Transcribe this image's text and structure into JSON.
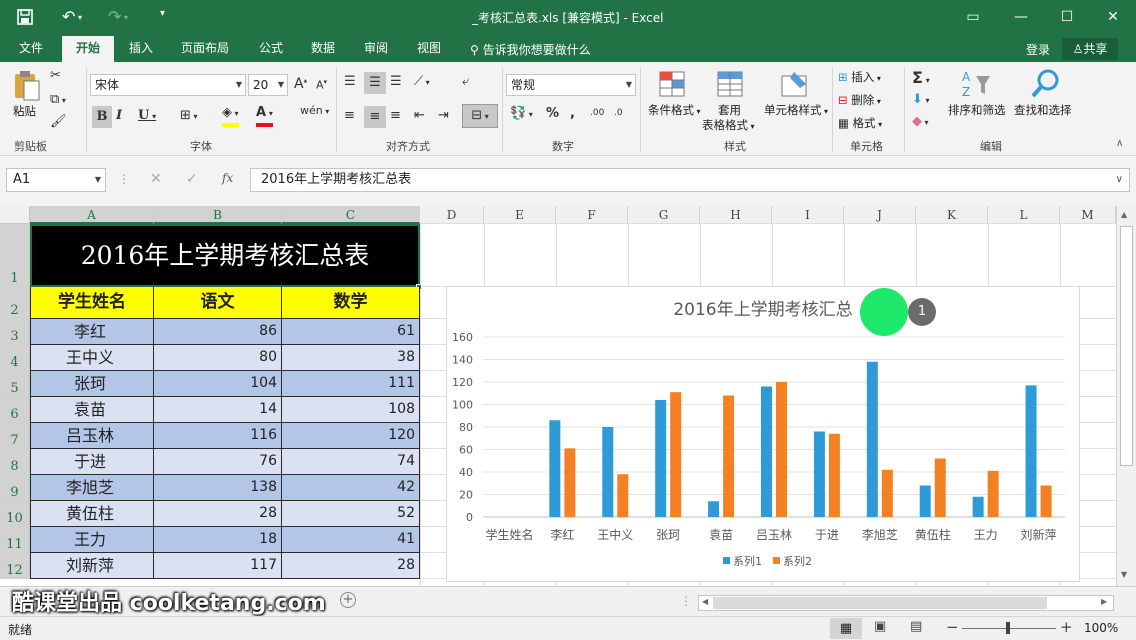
{
  "app": {
    "title": "_考核汇总表.xls  [兼容模式] - Excel",
    "accent": "#217346"
  },
  "tabs": [
    "文件",
    "开始",
    "插入",
    "页面布局",
    "公式",
    "数据",
    "审阅",
    "视图"
  ],
  "tellme": "告诉我你想要做什么",
  "account": {
    "login": "登录",
    "share": "共享"
  },
  "ribbon": {
    "clipboard": {
      "paste": "粘贴",
      "label": "剪贴板"
    },
    "font": {
      "name": "宋体",
      "size": "20",
      "label": "字体"
    },
    "alignment": {
      "label": "对齐方式"
    },
    "number": {
      "format": "常规",
      "label": "数字"
    },
    "styles": {
      "conditional": "条件格式",
      "table_format_1": "套用",
      "table_format_2": "表格格式",
      "cell_styles": "单元格样式",
      "label": "样式"
    },
    "cells": {
      "insert": "插入",
      "delete": "删除",
      "format": "格式",
      "label": "单元格"
    },
    "editing": {
      "sort": "排序和筛选",
      "find": "查找和选择",
      "label": "编辑"
    }
  },
  "formula_bar": {
    "name_box": "A1",
    "fx": "fx",
    "value": "2016年上学期考核汇总表"
  },
  "columns": [
    "A",
    "B",
    "C",
    "D",
    "E",
    "F",
    "G",
    "H",
    "I",
    "J",
    "K",
    "L",
    "M"
  ],
  "rows": [
    "1",
    "2",
    "3",
    "4",
    "5",
    "6",
    "7",
    "8",
    "9",
    "10",
    "11",
    "12"
  ],
  "sheet": {
    "title": "2016年上学期考核汇总表",
    "headers": [
      "学生姓名",
      "语文",
      "数学"
    ],
    "data": [
      [
        "李红",
        "86",
        "61"
      ],
      [
        "王中义",
        "80",
        "38"
      ],
      [
        "张珂",
        "104",
        "111"
      ],
      [
        "袁苗",
        "14",
        "108"
      ],
      [
        "吕玉林",
        "116",
        "120"
      ],
      [
        "于进",
        "76",
        "74"
      ],
      [
        "李旭芝",
        "138",
        "42"
      ],
      [
        "黄伍柱",
        "28",
        "52"
      ],
      [
        "王力",
        "18",
        "41"
      ],
      [
        "刘新萍",
        "117",
        "28"
      ]
    ]
  },
  "chart_data": {
    "type": "bar",
    "title": "2016年上学期考核汇总",
    "categories": [
      "学生姓名",
      "李红",
      "王中义",
      "张珂",
      "袁苗",
      "吕玉林",
      "于进",
      "李旭芝",
      "黄伍柱",
      "王力",
      "刘新萍"
    ],
    "series": [
      {
        "name": "系列1",
        "color": "#2e9bd6",
        "values": [
          null,
          86,
          80,
          104,
          14,
          116,
          76,
          138,
          28,
          18,
          117
        ]
      },
      {
        "name": "系列2",
        "color": "#f48024",
        "values": [
          null,
          61,
          38,
          111,
          108,
          120,
          74,
          42,
          52,
          41,
          28
        ]
      }
    ],
    "ylim": [
      0,
      160
    ],
    "yticks": [
      "0",
      "20",
      "40",
      "60",
      "80",
      "100",
      "120",
      "140",
      "160"
    ],
    "grid": true,
    "legend": "bottom"
  },
  "overlay": {
    "step": "1",
    "highlight_color": "#1ee86a"
  },
  "watermark": "酷课堂出品 coolketang.com",
  "status": {
    "ready": "就绪",
    "zoom": "100%"
  }
}
